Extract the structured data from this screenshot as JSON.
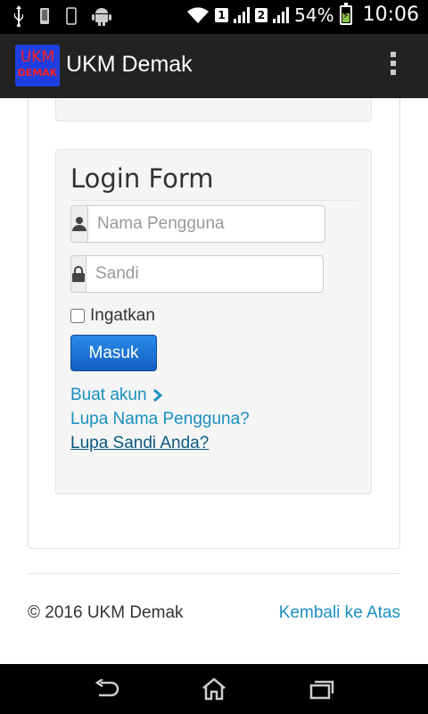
{
  "status_bar": {
    "icons": [
      "usb-icon",
      "phone-icon",
      "phone-outline-icon",
      "android-icon",
      "wifi-icon",
      "signal-icon"
    ],
    "sim1": "1",
    "sim2": "2",
    "battery_percent": "54%",
    "battery_level": 0.54,
    "time": "10:06"
  },
  "app_bar": {
    "logo_line1": "UKM",
    "logo_line2": "DEMAK",
    "title": "UKM Demak",
    "menu_icon": "overflow-menu-icon"
  },
  "login": {
    "title": "Login Form",
    "username_placeholder": "Nama Pengguna",
    "username_icon": "user-icon",
    "password_placeholder": "Sandi",
    "password_icon": "lock-icon",
    "remember_label": "Ingatkan",
    "remember_checked": false,
    "submit_label": "Masuk",
    "links": {
      "create_account": "Buat akun",
      "forgot_username": "Lupa Nama Pengguna?",
      "forgot_password": "Lupa Sandi Anda?"
    }
  },
  "footer": {
    "copyright": "© 2016 UKM Demak",
    "back_to_top": "Kembali ke Atas"
  },
  "nav_bar": {
    "icons": [
      "back-icon",
      "home-icon",
      "recent-apps-icon"
    ]
  },
  "colors": {
    "link": "#1a8fc1",
    "button": "#1f6fd2",
    "app_bar": "#222222"
  }
}
